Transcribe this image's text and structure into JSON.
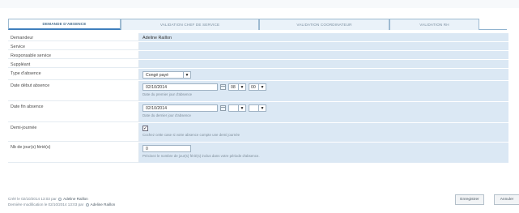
{
  "tabs": [
    {
      "label": "DEMANDE D'ABSENCE",
      "active": true
    },
    {
      "label": "VALIDATION CHEF DE SERVICE",
      "active": false
    },
    {
      "label": "VALIDATION COORDINATEUR",
      "active": false
    },
    {
      "label": "VALIDATION RH",
      "active": false
    }
  ],
  "form": {
    "demandeur": {
      "label": "Demandeur",
      "value": "Adeline Raillon"
    },
    "service": {
      "label": "Service",
      "value": ""
    },
    "responsable": {
      "label": "Responsable service",
      "value": ""
    },
    "suppleant": {
      "label": "Suppléant",
      "value": ""
    },
    "type_absence": {
      "label": "Type d'absence",
      "value": "Congé payé"
    },
    "date_debut": {
      "label": "Date début absence",
      "value": "02/10/2014",
      "hour": "08",
      "minute": "00",
      "hint": "Date du premier jour d'absence"
    },
    "date_fin": {
      "label": "Date fin absence",
      "value": "02/10/2014",
      "hour": "",
      "minute": "",
      "hint": "Date du dernier jour d'absence"
    },
    "demi_journee": {
      "label": "Demi-journée",
      "checked": true,
      "hint": "Cochez cette case si votre absence compte une demi journée"
    },
    "nb_jours": {
      "label": "Nb de jour(s) férié(s)",
      "value": "0",
      "hint": "Précisez le nombre de jour(s) férié(s) inclus dans votre période d'absence."
    }
  },
  "footer": {
    "created_prefix": "Créé le 02/10/2014 13:03  par",
    "created_by": "Adeline Raillon",
    "modified_prefix": "Dernière modification le 02/10/2014 13:03  par",
    "modified_by": "Adeline Raillon"
  },
  "buttons": {
    "save": "Enregistrer",
    "cancel": "Annuler"
  },
  "icons": {
    "calendar": "calendar-icon",
    "dropdown": "chevron-down-icon",
    "user": "user-icon"
  },
  "colors": {
    "field_bg": "#dbe8f4",
    "tab_border": "#9dbad1",
    "active_tab_accent": "#3f7fbd"
  }
}
